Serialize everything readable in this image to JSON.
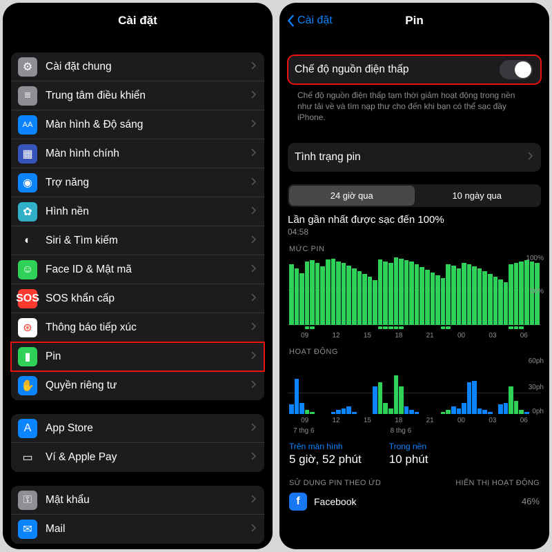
{
  "left": {
    "title": "Cài đặt",
    "groups": [
      [
        {
          "key": "general",
          "label": "Cài đặt chung",
          "icon": "gear",
          "bg": "ic-general"
        },
        {
          "key": "control",
          "label": "Trung tâm điều khiển",
          "icon": "sliders",
          "bg": "ic-control"
        },
        {
          "key": "display",
          "label": "Màn hình & Độ sáng",
          "icon": "AA",
          "bg": "ic-display"
        },
        {
          "key": "home",
          "label": "Màn hình chính",
          "icon": "grid",
          "bg": "ic-home"
        },
        {
          "key": "access",
          "label": "Trợ năng",
          "icon": "person",
          "bg": "ic-access"
        },
        {
          "key": "wallpaper",
          "label": "Hình nền",
          "icon": "flower",
          "bg": "ic-wallpaper"
        },
        {
          "key": "siri",
          "label": "Siri & Tìm kiếm",
          "icon": "siri",
          "bg": "ic-siri"
        },
        {
          "key": "faceid",
          "label": "Face ID & Mật mã",
          "icon": "face",
          "bg": "ic-faceid"
        },
        {
          "key": "sos",
          "label": "SOS khẩn cấp",
          "icon": "SOS",
          "bg": "ic-sos"
        },
        {
          "key": "exposure",
          "label": "Thông báo tiếp xúc",
          "icon": "virus",
          "bg": "ic-exposure"
        },
        {
          "key": "battery",
          "label": "Pin",
          "icon": "battery",
          "bg": "ic-battery",
          "highlight": true
        },
        {
          "key": "privacy",
          "label": "Quyền riêng tư",
          "icon": "hand",
          "bg": "ic-privacy"
        }
      ],
      [
        {
          "key": "appstore",
          "label": "App Store",
          "icon": "A",
          "bg": "ic-appstore"
        },
        {
          "key": "wallet",
          "label": "Ví & Apple Pay",
          "icon": "wallet",
          "bg": "ic-wallet"
        }
      ],
      [
        {
          "key": "passwords",
          "label": "Mật khẩu",
          "icon": "key",
          "bg": "ic-passwords"
        },
        {
          "key": "mail",
          "label": "Mail",
          "icon": "mail",
          "bg": "ic-mail"
        }
      ]
    ]
  },
  "right": {
    "back": "Cài đặt",
    "title": "Pin",
    "low_power_label": "Chế độ nguồn điện thấp",
    "low_power_on": false,
    "low_power_footnote": "Chế độ nguồn điện thấp tạm thời giảm hoạt động trong nền như tải về và tìm nạp thư cho đến khi bạn có thể sạc đầy iPhone.",
    "health_label": "Tình trạng pin",
    "segmented": {
      "options": [
        "24 giờ qua",
        "10 ngày qua"
      ],
      "selected": 0
    },
    "last_charged_label": "Lần gần nhất được sạc đến 100%",
    "last_charged_time": "04:58",
    "battery_section": "MỨC PIN",
    "activity_section": "HOẠT ĐỘNG",
    "y_battery": [
      "100%",
      "50%"
    ],
    "y_activity": [
      "60ph",
      "30ph",
      "0ph"
    ],
    "x_ticks": [
      "09",
      "12",
      "15",
      "18",
      "21",
      "00",
      "03",
      "06"
    ],
    "x_day_labels": [
      "7 thg 6",
      "8 thg 6"
    ],
    "chart_data": {
      "type": "bar",
      "battery": {
        "ylim": [
          0,
          100
        ],
        "values": [
          88,
          82,
          75,
          92,
          94,
          90,
          85,
          95,
          96,
          92,
          90,
          86,
          82,
          78,
          74,
          70,
          65,
          95,
          92,
          90,
          98,
          96,
          94,
          92,
          88,
          84,
          80,
          76,
          72,
          68,
          88,
          86,
          82,
          90,
          88,
          85,
          82,
          78,
          74,
          70,
          66,
          62,
          88,
          90,
          92,
          94,
          92,
          90
        ]
      },
      "charging_bars": [
        3,
        4,
        17,
        18,
        19,
        20,
        21,
        29,
        30,
        42,
        43,
        44
      ],
      "activity": {
        "ylim": [
          0,
          60
        ],
        "values": [
          10,
          38,
          12,
          4,
          2,
          0,
          0,
          0,
          2,
          4,
          6,
          8,
          2,
          0,
          0,
          0,
          30,
          34,
          12,
          6,
          42,
          30,
          8,
          4,
          2,
          0,
          0,
          0,
          0,
          2,
          4,
          8,
          6,
          12,
          34,
          36,
          6,
          4,
          2,
          0,
          10,
          12,
          30,
          14,
          4,
          2,
          0,
          0
        ]
      }
    },
    "usage": {
      "on_screen": {
        "label": "Trên màn hình",
        "value": "5 giờ, 52 phút"
      },
      "background": {
        "label": "Trong nền",
        "value": "10 phút"
      }
    },
    "app_header": {
      "left": "SỬ DỤNG PIN THEO ỨD",
      "right": "HIỂN THỊ HOẠT ĐỘNG"
    },
    "apps": [
      {
        "name": "Facebook",
        "pct": "46%"
      }
    ]
  }
}
